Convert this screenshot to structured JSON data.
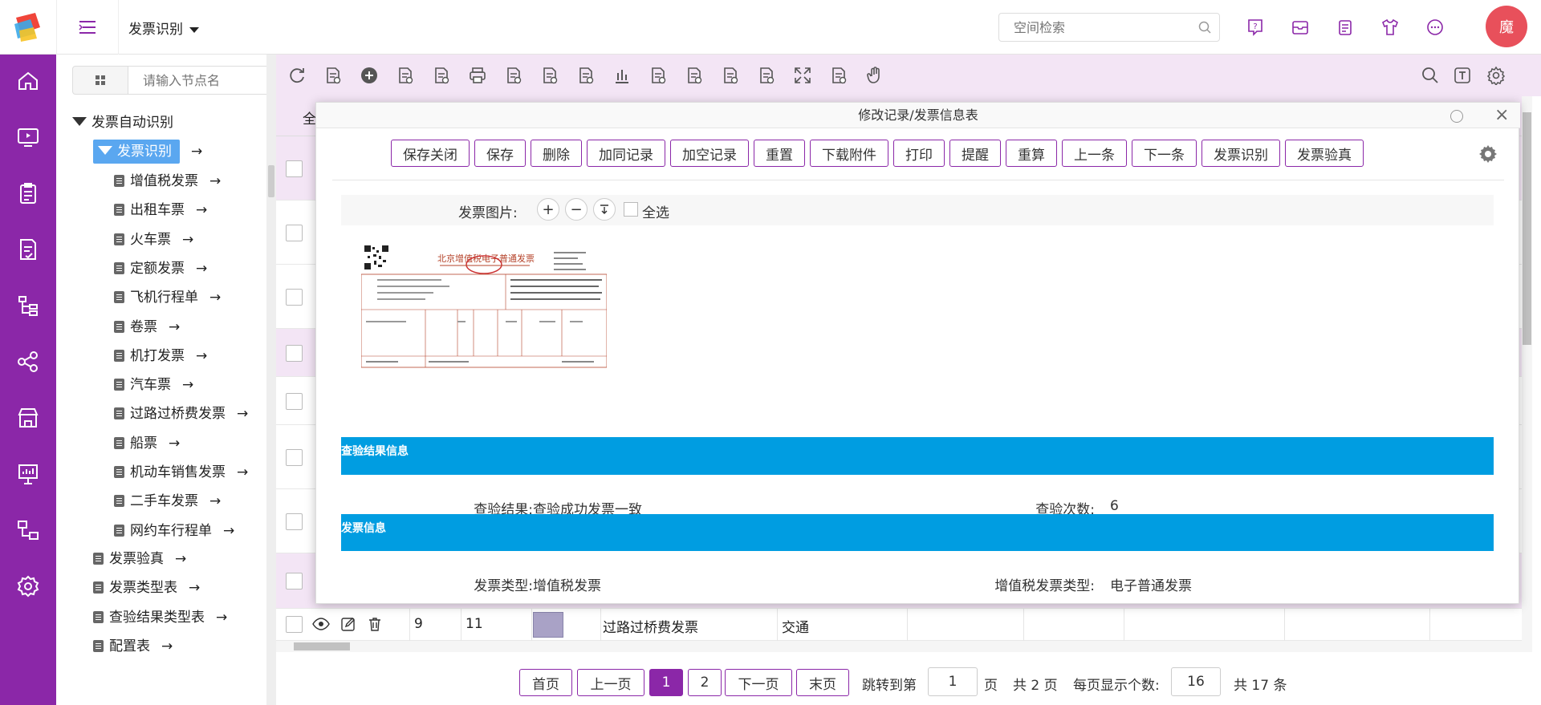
{
  "header": {
    "app_title": "发票识别",
    "search_placeholder": "空间检索",
    "avatar_text": "魔",
    "icons": [
      "help-icon",
      "mail-icon",
      "notepad-icon",
      "shirt-icon",
      "chat-icon"
    ]
  },
  "rail": {
    "icons": [
      "home-icon",
      "monitor-play-icon",
      "clipboard-icon",
      "document-check-icon",
      "org-tree-icon",
      "share-icon",
      "store-icon",
      "presentation-icon",
      "flow-icon",
      "settings-icon"
    ]
  },
  "tree": {
    "search_placeholder": "请输入节点名",
    "root": "发票自动识别",
    "selected": "发票识别",
    "children": [
      "增值税发票",
      "出租车票",
      "火车票",
      "定额发票",
      "飞机行程单",
      "卷票",
      "机打发票",
      "汽车票",
      "过路过桥费发票",
      "船票",
      "机动车销售发票",
      "二手车发票",
      "网约车行程单"
    ],
    "siblings": [
      "发票验真",
      "发票类型表",
      "查验结果类型表",
      "配置表"
    ],
    "arrow": "→"
  },
  "grid": {
    "header_first": "全",
    "visible_row": {
      "col1": "9",
      "col2": "11",
      "type": "过路过桥费发票",
      "category": "交通"
    }
  },
  "pager": {
    "first": "首页",
    "prev": "上一页",
    "page1": "1",
    "page2": "2",
    "next": "下一页",
    "last": "末页",
    "jump_label": "跳转到第",
    "jump_value": "1",
    "page_unit": "页",
    "total_pages": "共 2 页",
    "per_page_label": "每页显示个数:",
    "per_page_value": "16",
    "total_items": "共 17 条"
  },
  "modal": {
    "title": "修改记录/发票信息表",
    "buttons": [
      "保存关闭",
      "保存",
      "删除",
      "加同记录",
      "加空记录",
      "重置",
      "下载附件",
      "打印",
      "提醒",
      "重算",
      "上一条",
      "下一条",
      "发票识别",
      "发票验真"
    ],
    "image_label": "发票图片:",
    "zoom_in": "+",
    "zoom_out": "−",
    "select_all": "全选",
    "invoice_header_text": "北京增值税电子普通发票",
    "section_check": "查验结果信息",
    "check_result_label": "查验结果:",
    "check_result_value": "查验成功发票一致",
    "check_count_label": "查验次数:",
    "check_count_value": "6",
    "section_invoice": "发票信息",
    "invoice_type_label": "发票类型:",
    "invoice_type_value": "增值税发票",
    "vat_type_label": "增值税发票类型:",
    "vat_type_value": "电子普通发票"
  },
  "colors": {
    "brand": "#8b27a8",
    "toolbar_bg": "#f3e5f5",
    "section_blue": "#009de1",
    "avatar_red": "#e8505b",
    "tree_selected": "#5aa7f0"
  }
}
